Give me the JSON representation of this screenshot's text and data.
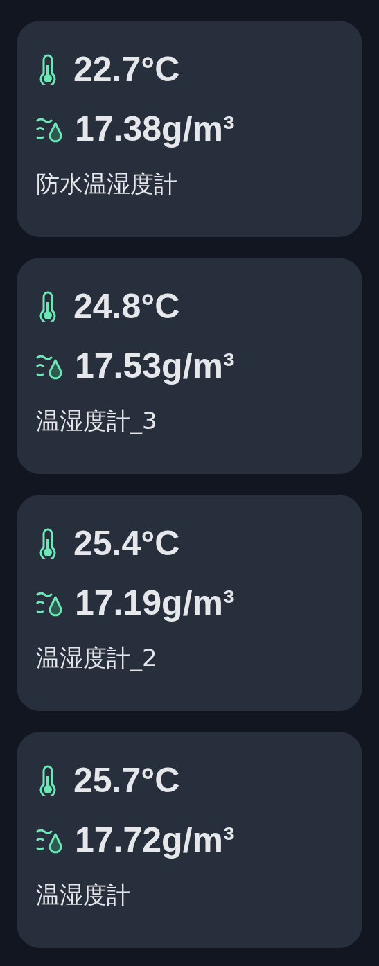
{
  "sensors": [
    {
      "temperature": "22.7°C",
      "humidity": "17.38g/m³",
      "name": "防水温湿度計"
    },
    {
      "temperature": "24.8°C",
      "humidity": "17.53g/m³",
      "name": "温湿度計_3"
    },
    {
      "temperature": "25.4°C",
      "humidity": "17.19g/m³",
      "name": "温湿度計_2"
    },
    {
      "temperature": "25.7°C",
      "humidity": "17.72g/m³",
      "name": "温湿度計"
    }
  ]
}
